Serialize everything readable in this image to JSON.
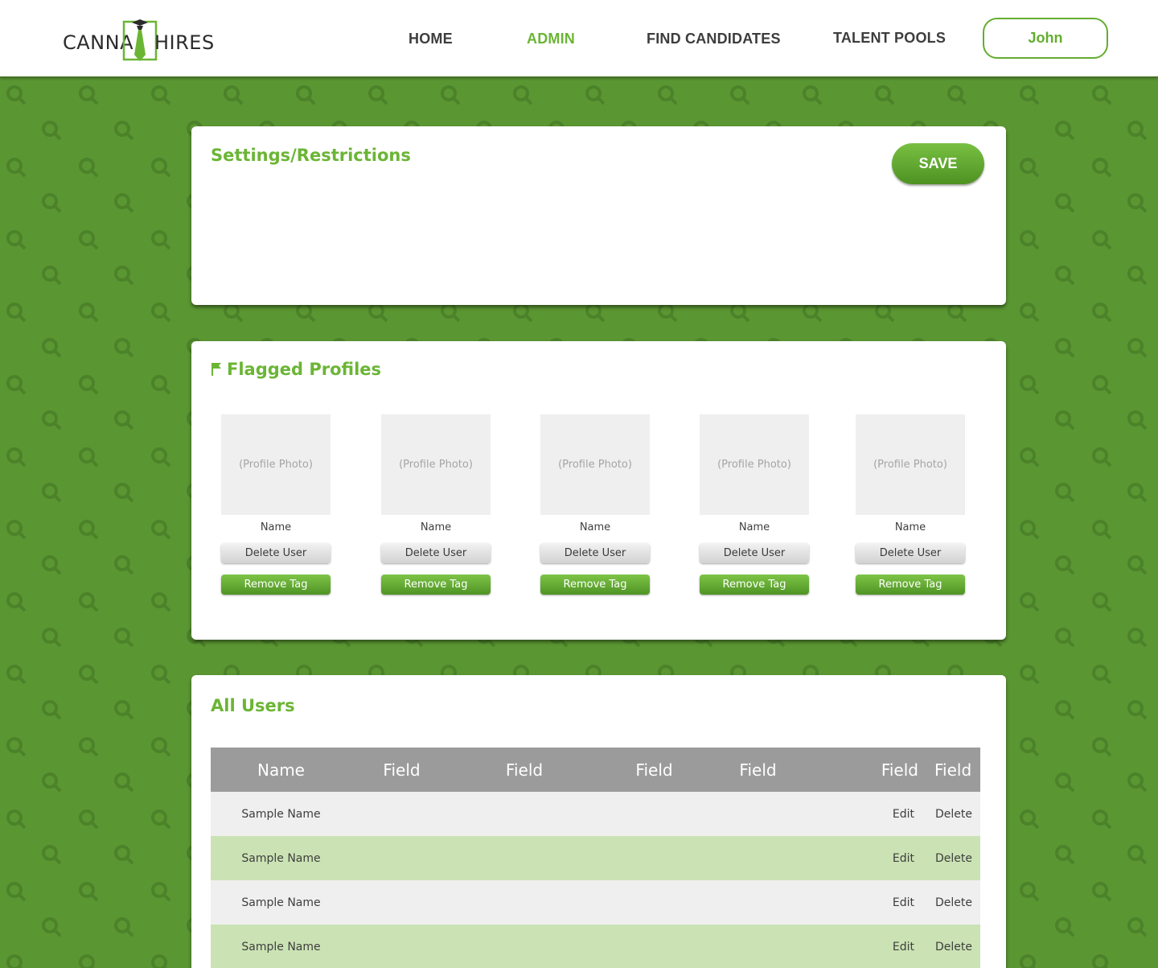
{
  "header": {
    "logo": {
      "left_text": "CANNA",
      "right_text": "HIRES"
    },
    "nav": [
      {
        "label": "HOME",
        "active": false
      },
      {
        "label": "ADMIN",
        "active": true
      },
      {
        "label": "FIND CANDIDATES",
        "active": false
      },
      {
        "label": "TALENT POOLS",
        "active": false
      }
    ],
    "user_button": "John"
  },
  "settings": {
    "title": "Settings/Restrictions",
    "save_label": "SAVE"
  },
  "flagged": {
    "title": "Flagged Profiles",
    "profiles": [
      {
        "photo": "(Profile Photo)",
        "name": "Name",
        "delete_label": "Delete User",
        "remove_label": "Remove Tag"
      },
      {
        "photo": "(Profile Photo)",
        "name": "Name",
        "delete_label": "Delete User",
        "remove_label": "Remove Tag"
      },
      {
        "photo": "(Profile Photo)",
        "name": "Name",
        "delete_label": "Delete User",
        "remove_label": "Remove Tag"
      },
      {
        "photo": "(Profile Photo)",
        "name": "Name",
        "delete_label": "Delete User",
        "remove_label": "Remove Tag"
      },
      {
        "photo": "(Profile Photo)",
        "name": "Name",
        "delete_label": "Delete User",
        "remove_label": "Remove Tag"
      }
    ]
  },
  "all_users": {
    "title": "All Users",
    "columns": [
      "Name",
      "Field",
      "Field",
      "Field",
      "Field",
      "Field",
      "Field"
    ],
    "rows": [
      {
        "name": "Sample Name",
        "edit": "Edit",
        "delete": "Delete"
      },
      {
        "name": "Sample Name",
        "edit": "Edit",
        "delete": "Delete"
      },
      {
        "name": "Sample Name",
        "edit": "Edit",
        "delete": "Delete"
      },
      {
        "name": "Sample Name",
        "edit": "Edit",
        "delete": "Delete"
      }
    ]
  },
  "colors": {
    "brand_green": "#6bb535",
    "page_background": "#5a9632",
    "table_header": "#9b9b9b",
    "row_light": "#efefef",
    "row_green": "#cbe3b4"
  },
  "icons": {
    "background_pattern": "magnifier-icon",
    "flag": "flag-icon",
    "logo_mark": "graduate-tie-icon"
  }
}
